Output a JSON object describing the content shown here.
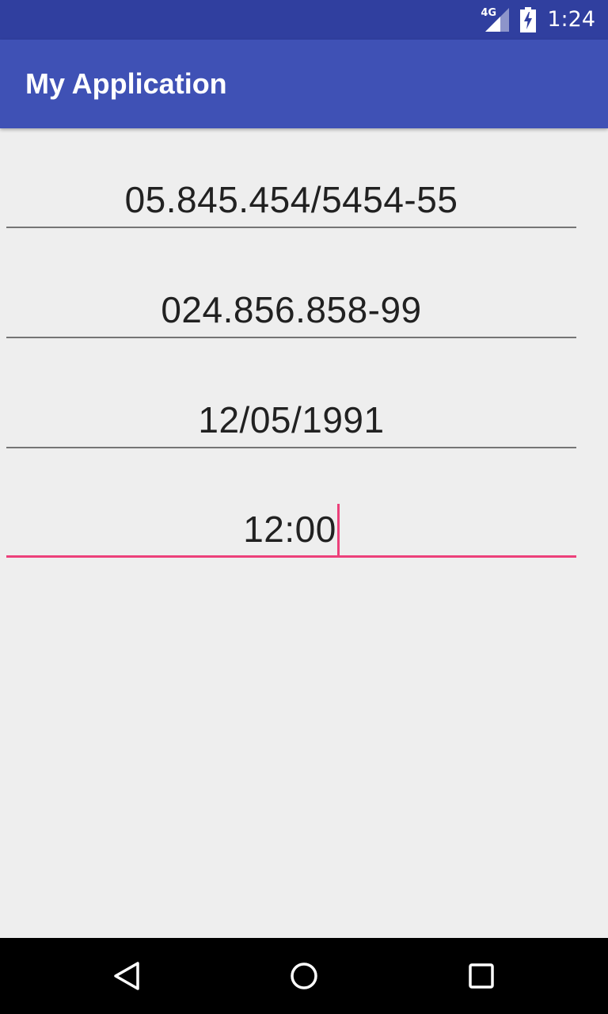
{
  "status_bar": {
    "network_type": "4G",
    "time": "1:24",
    "icons": [
      "signal-icon",
      "battery-charging-icon"
    ]
  },
  "app_bar": {
    "title": "My Application"
  },
  "fields": [
    {
      "value": "05.845.454/5454-55",
      "focused": false
    },
    {
      "value": "024.856.858-99",
      "focused": false
    },
    {
      "value": "12/05/1991",
      "focused": false
    },
    {
      "value": "12:00",
      "focused": true
    }
  ],
  "nav_bar": {
    "icons": [
      "back-icon",
      "home-icon",
      "recents-icon"
    ]
  },
  "colors": {
    "status_bar": "#303f9f",
    "app_bar": "#3f51b5",
    "accent": "#ec407a",
    "background": "#eeeeee",
    "text": "#212121"
  }
}
